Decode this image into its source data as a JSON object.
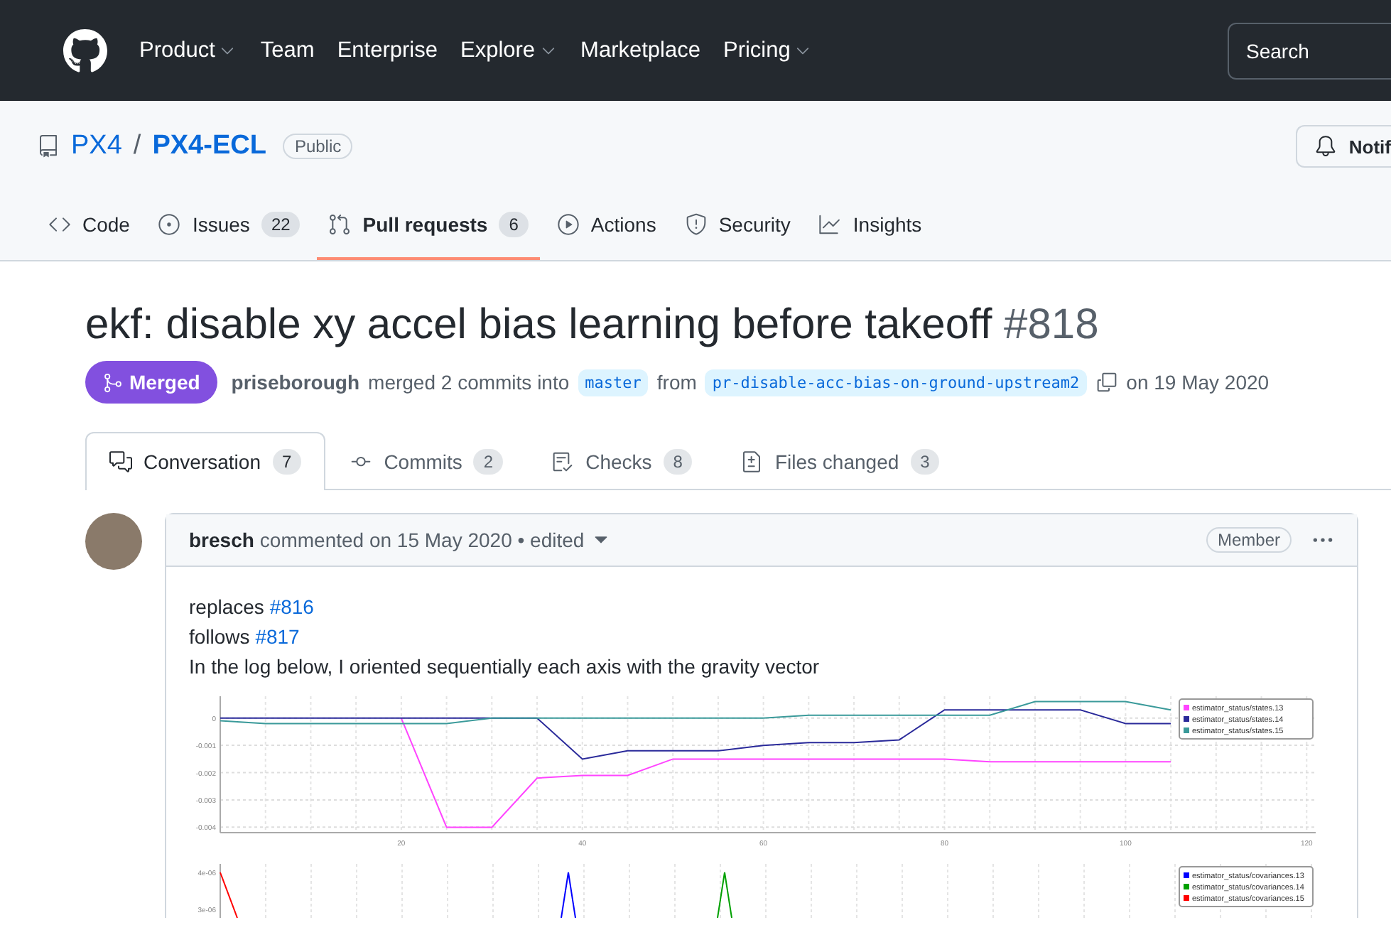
{
  "header": {
    "nav": [
      {
        "label": "Product",
        "has_menu": true
      },
      {
        "label": "Team",
        "has_menu": false
      },
      {
        "label": "Enterprise",
        "has_menu": false
      },
      {
        "label": "Explore",
        "has_menu": true
      },
      {
        "label": "Marketplace",
        "has_menu": false
      },
      {
        "label": "Pricing",
        "has_menu": true
      }
    ],
    "search": {
      "placeholder": "Search"
    }
  },
  "repo": {
    "owner": "PX4",
    "separator": "/",
    "name": "PX4-ECL",
    "visibility": "Public",
    "notifications": "Notif"
  },
  "repo_tabs": [
    {
      "label": "Code",
      "selected": false
    },
    {
      "label": "Issues",
      "count": "22",
      "selected": false
    },
    {
      "label": "Pull requests",
      "count": "6",
      "selected": true
    },
    {
      "label": "Actions",
      "selected": false
    },
    {
      "label": "Security",
      "selected": false
    },
    {
      "label": "Insights",
      "selected": false
    }
  ],
  "pull_request": {
    "title": "ekf: disable xy accel bias learning before takeoff",
    "number": "#818",
    "state": "Merged",
    "author": "priseborough",
    "action": "merged 2 commits into",
    "base_branch": "master",
    "from": "from",
    "head_branch": "pr-disable-acc-bias-on-ground-upstream2",
    "date": "on 19 May 2020"
  },
  "pr_tabs": [
    {
      "label": "Conversation",
      "count": "7",
      "selected": true
    },
    {
      "label": "Commits",
      "count": "2",
      "selected": false
    },
    {
      "label": "Checks",
      "count": "8",
      "selected": false
    },
    {
      "label": "Files changed",
      "count": "3",
      "selected": false
    }
  ],
  "comment": {
    "author": "bresch",
    "meta": "commented on 15 May 2020 • edited",
    "role": "Member",
    "lines": [
      {
        "text": "replaces ",
        "link": "#816"
      },
      {
        "text": "follows ",
        "link": "#817"
      },
      {
        "text": "In the log below, I oriented sequentially each axis with the gravity vector"
      }
    ],
    "charts": [
      {
        "chart_data": {
          "type": "line",
          "x": [
            0,
            5,
            10,
            15,
            20,
            25,
            30,
            35,
            40,
            45,
            50,
            55,
            60,
            65,
            70,
            75,
            80,
            85,
            90,
            95,
            100,
            105
          ],
          "xlim": [
            0,
            121
          ],
          "ylim": [
            -0.0042,
            0.0008
          ],
          "xticks": [
            20,
            40,
            60,
            80,
            100,
            120
          ],
          "yticks": [
            {
              "value": 0,
              "label": "0"
            },
            {
              "value": -0.001,
              "label": "-0.001"
            },
            {
              "value": -0.002,
              "label": "-0.002"
            },
            {
              "value": -0.003,
              "label": "-0.003"
            },
            {
              "value": -0.004,
              "label": "-0.004"
            }
          ],
          "series": [
            {
              "name": "estimator_status/states.13",
              "color": "#ff44ff",
              "values": [
                null,
                null,
                null,
                null,
                0,
                -0.004,
                -0.004,
                -0.0022,
                -0.0021,
                -0.0021,
                -0.0015,
                -0.0015,
                -0.0015,
                -0.0015,
                -0.0015,
                -0.0015,
                -0.0015,
                -0.0016,
                -0.0016,
                -0.0016,
                -0.0016,
                -0.0016
              ]
            },
            {
              "name": "estimator_status/states.14",
              "color": "#2a2a9a",
              "values": [
                0,
                0,
                0,
                0,
                0,
                0,
                0,
                0,
                -0.0015,
                -0.0012,
                -0.0012,
                -0.0012,
                -0.001,
                -0.0009,
                -0.0009,
                -0.0008,
                0.0003,
                0.0003,
                0.0003,
                0.0003,
                -0.0002,
                -0.0002
              ]
            },
            {
              "name": "estimator_status/states.15",
              "color": "#3a9a9a",
              "values": [
                -0.0001,
                -0.0002,
                -0.0002,
                -0.0002,
                -0.0002,
                -0.0002,
                0,
                0,
                0,
                0,
                0,
                0,
                0,
                0.0001,
                0.0001,
                0.0001,
                0.0001,
                0.0001,
                0.0006,
                0.0006,
                0.0006,
                0.0003
              ]
            }
          ],
          "grid": true,
          "legend": true
        }
      },
      {
        "kind": "picture",
        "y_tick_labels": [
          "4e-06",
          "3e-06"
        ],
        "legend": [
          {
            "name": "estimator_status/covariances.13",
            "color": "#0000ff"
          },
          {
            "name": "estimator_status/covariances.14",
            "color": "#00a000"
          },
          {
            "name": "estimator_status/covariances.15",
            "color": "#ff0000"
          }
        ]
      }
    ]
  }
}
